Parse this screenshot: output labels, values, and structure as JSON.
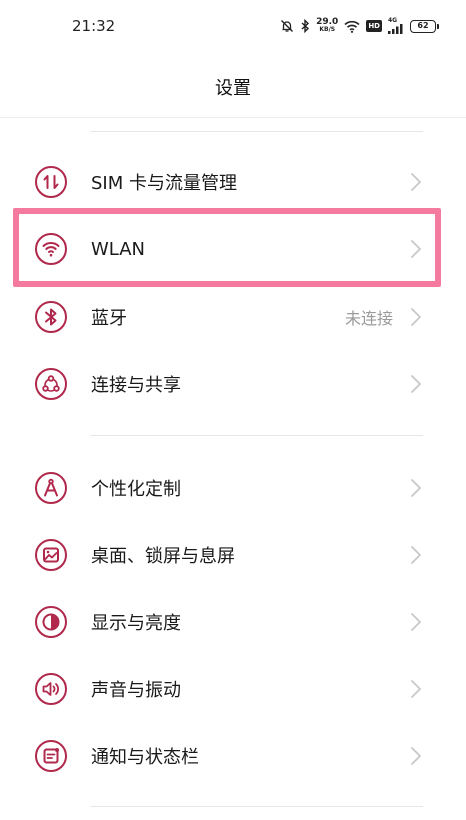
{
  "status_bar": {
    "time": "21:32",
    "net_speed_value": "29.0",
    "net_speed_unit": "KB/S",
    "hd_label": "HD",
    "network_label": "4G",
    "battery_level": "62"
  },
  "header": {
    "title": "设置"
  },
  "groups": [
    {
      "items": [
        {
          "label": "SIM 卡与流量管理",
          "icon": "sim-data-icon"
        },
        {
          "label": "WLAN",
          "icon": "wifi-icon"
        },
        {
          "label": "蓝牙",
          "value": "未连接",
          "icon": "bluetooth-icon"
        },
        {
          "label": "连接与共享",
          "icon": "connection-share-icon"
        }
      ]
    },
    {
      "items": [
        {
          "label": "个性化定制",
          "icon": "personalization-icon"
        },
        {
          "label": "桌面、锁屏与息屏",
          "icon": "wallpaper-icon"
        },
        {
          "label": "显示与亮度",
          "icon": "display-brightness-icon"
        },
        {
          "label": "声音与振动",
          "icon": "sound-icon"
        },
        {
          "label": "通知与状态栏",
          "icon": "notification-icon"
        }
      ]
    }
  ],
  "colors": {
    "icon_accent": "#b0284b",
    "highlight": "#f57aa0",
    "chevron": "#c8c8c8",
    "value_text": "#9a9a9a"
  }
}
